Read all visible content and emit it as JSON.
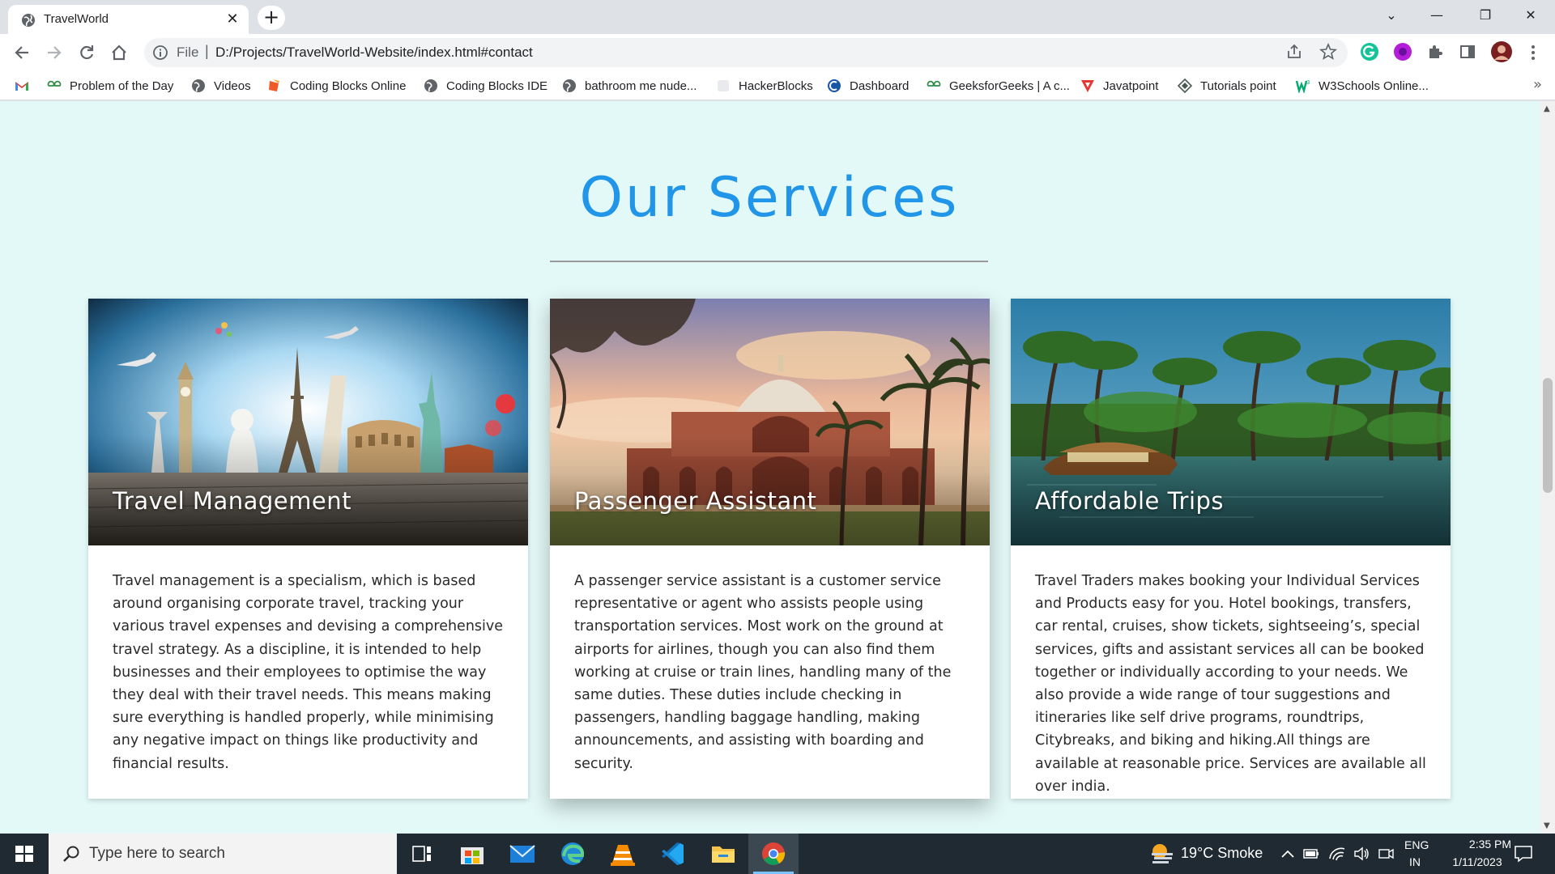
{
  "browser": {
    "tab_title": "TravelWorld",
    "tab_close": "✕",
    "new_tab": "+",
    "window_controls": [
      "⌄",
      "—",
      "❐",
      "✕"
    ],
    "url_scheme": "File",
    "url_separator": "|",
    "url": "D:/Projects/TravelWorld-Website/index.html#contact",
    "bookmarks": [
      {
        "label": "Problem of the Day",
        "icon": "gfg-icon"
      },
      {
        "label": "Videos",
        "icon": "globe-icon"
      },
      {
        "label": "Coding Blocks Online",
        "icon": "codingblocks-icon"
      },
      {
        "label": "Coding Blocks IDE",
        "icon": "globe-icon"
      },
      {
        "label": "bathroom me nude...",
        "icon": "globe-icon"
      },
      {
        "label": "HackerBlocks",
        "icon": "hackerblocks-icon"
      },
      {
        "label": "Dashboard",
        "icon": "dashboard-icon"
      },
      {
        "label": "GeeksforGeeks | A c...",
        "icon": "gfg-icon"
      },
      {
        "label": "Javatpoint",
        "icon": "javatpoint-icon"
      },
      {
        "label": "Tutorials point",
        "icon": "tutorialspoint-icon"
      },
      {
        "label": "W3Schools Online...",
        "icon": "w3schools-icon"
      }
    ],
    "bookmarks_more": "»"
  },
  "page": {
    "section_title": "Our Services",
    "cards": [
      {
        "title": "Travel Management",
        "text": "Travel management is a specialism, which is based around organising corporate travel, tracking your various travel expenses and devising a comprehensive travel strategy. As a discipline, it is intended to help businesses and their employees to optimise the way they deal with their travel needs. This means making sure everything is handled properly, while minimising any negative impact on things like productivity and financial results."
      },
      {
        "title": "Passenger Assistant",
        "text": "A passenger service assistant is a customer service representative or agent who assists people using transportation services. Most work on the ground at airports for airlines, though you can also find them working at cruise or train lines, handling many of the same duties. These duties include checking in passengers, handling baggage handling, making announcements, and assisting with boarding and security."
      },
      {
        "title": "Affordable Trips",
        "text": "Travel Traders makes booking your Individual Services and Products easy for you. Hotel bookings, transfers, car rental, cruises, show tickets, sightseeing’s, special services, gifts and assistant services all can be booked together or individually according to your needs. We also provide a wide range of tour suggestions and itineraries like self drive programs, roundtrips, Citybreaks, and biking and hiking.All things are available at reasonable price. Services are available all over india."
      }
    ]
  },
  "taskbar": {
    "search_placeholder": "Type here to search",
    "weather": "19°C  Smoke",
    "language": "ENG",
    "region": "IN",
    "time": "2:35 PM",
    "date": "1/11/2023"
  },
  "colors": {
    "accent": "#2196e8",
    "page_background": "#e3f9f7",
    "taskbar": "#1f2a33"
  }
}
